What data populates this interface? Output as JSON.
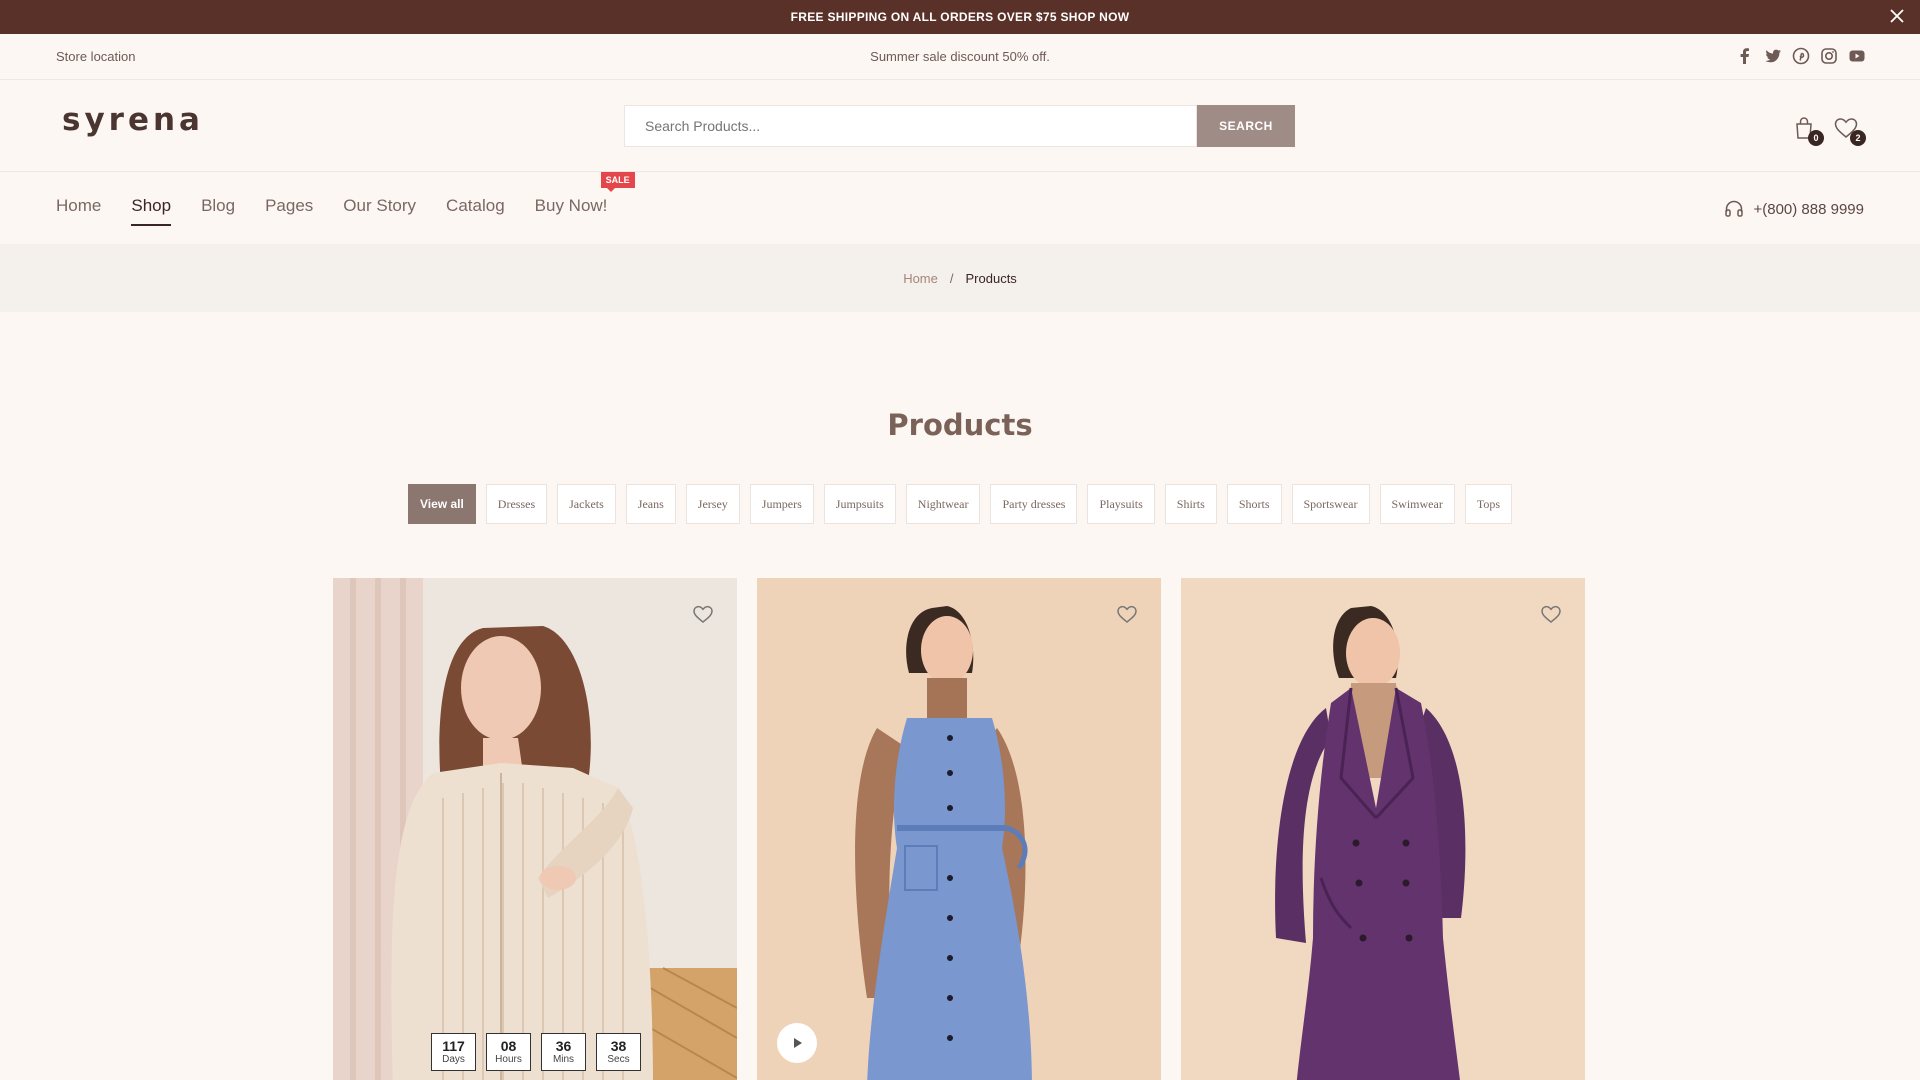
{
  "announcement": {
    "text": "FREE SHIPPING ON ALL ORDERS OVER $75 SHOP NOW"
  },
  "topbar": {
    "store_location": "Store location",
    "promo": "Summer sale discount 50% off.",
    "social": [
      "facebook-icon",
      "twitter-icon",
      "pinterest-icon",
      "instagram-icon",
      "youtube-icon"
    ]
  },
  "header": {
    "logo": "syrena",
    "search_placeholder": "Search Products...",
    "search_button": "SEARCH",
    "cart_count": "0",
    "wishlist_count": "2"
  },
  "nav": {
    "items": [
      "Home",
      "Shop",
      "Blog",
      "Pages",
      "Our Story",
      "Catalog",
      "Buy Now!"
    ],
    "active": "Shop",
    "sale_badge": "SALE",
    "phone": "+(800) 888 9999"
  },
  "breadcrumb": {
    "home": "Home",
    "separator": "/",
    "current": "Products"
  },
  "page_title": "Products",
  "filters": [
    "View all",
    "Dresses",
    "Jackets",
    "Jeans",
    "Jersey",
    "Jumpers",
    "Jumpsuits",
    "Nightwear",
    "Party dresses",
    "Playsuits",
    "Shirts",
    "Shorts",
    "Sportswear",
    "Swimwear",
    "Tops"
  ],
  "countdown": [
    {
      "value": "117",
      "label": "Days"
    },
    {
      "value": "08",
      "label": "Hours"
    },
    {
      "value": "36",
      "label": "Mins"
    },
    {
      "value": "38",
      "label": "Secs"
    }
  ],
  "colors": {
    "announce_bg": "#5a3128",
    "accent": "#8b7670",
    "sale_red": "#e3474c",
    "page_bg": "#fdf7f4"
  }
}
